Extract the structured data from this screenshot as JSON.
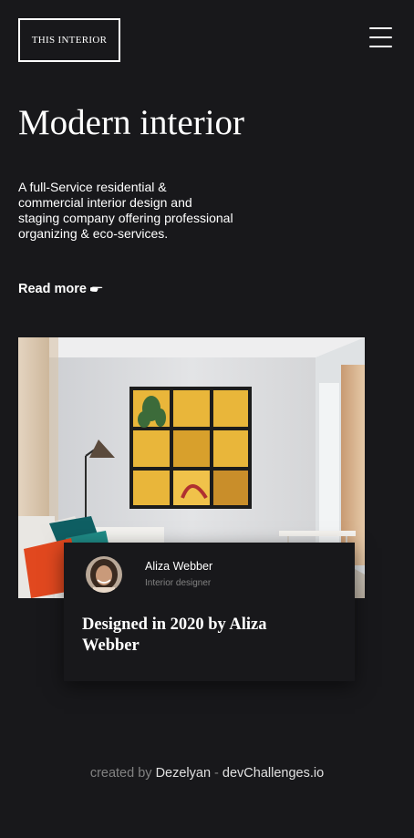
{
  "header": {
    "logo_text": "THIS INTERIOR",
    "menu_icon": "hamburger-menu-icon"
  },
  "hero": {
    "title": "Modern interior",
    "description": "A full-Service residential & commercial interior design and staging company offering professional organizing & eco-services.",
    "read_more_label": "Read more",
    "read_more_icon": "pointing-hand-icon"
  },
  "feature": {
    "image_alt": "Living room with yellow wall art, floor lamp and white sofa",
    "author_name": "Aliza Webber",
    "author_role": "Interior designer",
    "title": "Designed in 2020 by Aliza Webber"
  },
  "footer": {
    "prefix": "created by",
    "author": "Dezelyan",
    "separator": "-",
    "site": "devChallenges.io"
  },
  "colors": {
    "background": "#18181b",
    "text": "#ffffff",
    "muted": "#828282"
  }
}
